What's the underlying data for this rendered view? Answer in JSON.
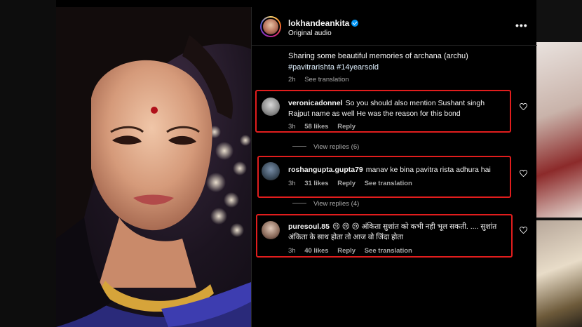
{
  "post": {
    "username": "lokhandeankita",
    "audio": "Original audio",
    "menu_glyph": "•••",
    "caption_text": "Sharing some beautiful memories of archana (archu)",
    "caption_tags": "#pavitrarishta #14yearsold",
    "caption_time": "2h",
    "caption_translation": "See translation"
  },
  "comments": [
    {
      "username": "veronicadonnel",
      "text": "So you should also mention Sushant singh Rajput name as well He was the reason for this bond",
      "time": "3h",
      "likes": "58 likes",
      "reply": "Reply",
      "translation": ""
    },
    {
      "username": "roshangupta.gupta79",
      "text": "manav ke bina pavitra rista adhura hai",
      "time": "3h",
      "likes": "31 likes",
      "reply": "Reply",
      "translation": "See translation"
    },
    {
      "username": "puresoul.85",
      "text": "😢 😢 😢 अंकिता सुशांत को कभी नही भूल सकती. .... सुशांत अंकिता के साथ होता तो आज वो जिंदा होता",
      "time": "3h",
      "likes": "40 likes",
      "reply": "Reply",
      "translation": "See translation"
    }
  ],
  "view_replies": [
    {
      "label": "View replies (6)"
    },
    {
      "label": "View replies (4)"
    }
  ],
  "colors": {
    "highlight_box": "#e11d1d",
    "verified": "#0095f6",
    "muted_text": "#a8a8a8"
  }
}
